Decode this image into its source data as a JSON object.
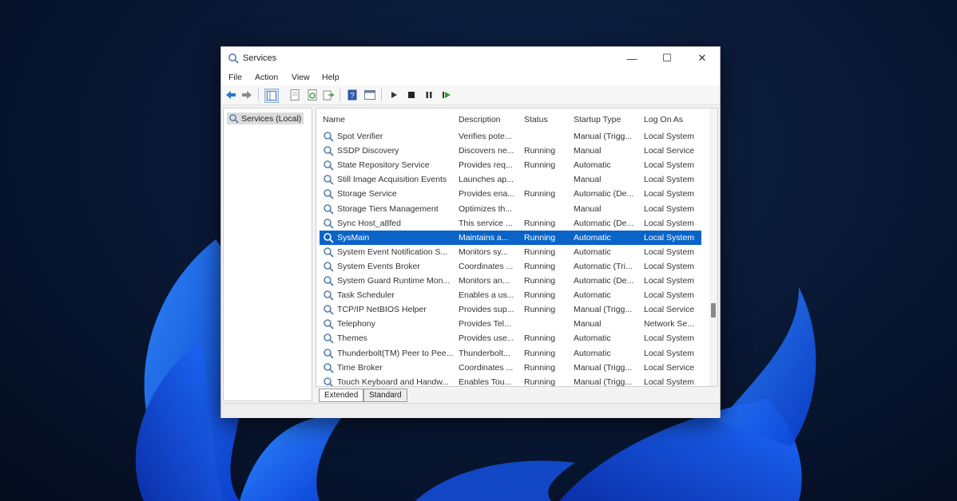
{
  "window": {
    "title": "Services",
    "caption": {
      "minimize": "—",
      "maximize": "☐",
      "close": "✕"
    }
  },
  "menu": [
    "File",
    "Action",
    "View",
    "Help"
  ],
  "toolbar": [
    "back-icon",
    "forward-icon",
    "console-tree-icon",
    "properties-icon",
    "refresh-icon",
    "export-icon",
    "help-icon",
    "view-icon",
    "play-icon",
    "stop-icon",
    "pause-icon",
    "restart-icon"
  ],
  "tree": {
    "label": "Services (Local)"
  },
  "table": {
    "columns": [
      "Name",
      "Description",
      "Status",
      "Startup Type",
      "Log On As"
    ],
    "selected_index": 7,
    "rows": [
      [
        "Spot Verifier",
        "Verifies pote...",
        "",
        "Manual (Trigg...",
        "Local System"
      ],
      [
        "SSDP Discovery",
        "Discovers ne...",
        "Running",
        "Manual",
        "Local Service"
      ],
      [
        "State Repository Service",
        "Provides req...",
        "Running",
        "Automatic",
        "Local System"
      ],
      [
        "Still Image Acquisition Events",
        "Launches ap...",
        "",
        "Manual",
        "Local System"
      ],
      [
        "Storage Service",
        "Provides ena...",
        "Running",
        "Automatic (De...",
        "Local System"
      ],
      [
        "Storage Tiers Management",
        "Optimizes th...",
        "",
        "Manual",
        "Local System"
      ],
      [
        "Sync Host_a8fed",
        "This service ...",
        "Running",
        "Automatic (De...",
        "Local System"
      ],
      [
        "SysMain",
        "Maintains a...",
        "Running",
        "Automatic",
        "Local System"
      ],
      [
        "System Event Notification S...",
        "Monitors sy...",
        "Running",
        "Automatic",
        "Local System"
      ],
      [
        "System Events Broker",
        "Coordinates ...",
        "Running",
        "Automatic (Tri...",
        "Local System"
      ],
      [
        "System Guard Runtime Mon...",
        "Monitors an...",
        "Running",
        "Automatic (De...",
        "Local System"
      ],
      [
        "Task Scheduler",
        "Enables a us...",
        "Running",
        "Automatic",
        "Local System"
      ],
      [
        "TCP/IP NetBIOS Helper",
        "Provides sup...",
        "Running",
        "Manual (Trigg...",
        "Local Service"
      ],
      [
        "Telephony",
        "Provides Tel...",
        "",
        "Manual",
        "Network Se..."
      ],
      [
        "Themes",
        "Provides use...",
        "Running",
        "Automatic",
        "Local System"
      ],
      [
        "Thunderbolt(TM) Peer to Pee...",
        "Thunderbolt...",
        "Running",
        "Automatic",
        "Local System"
      ],
      [
        "Time Broker",
        "Coordinates ...",
        "Running",
        "Manual (Trigg...",
        "Local Service"
      ],
      [
        "Touch Keyboard and Handw...",
        "Enables Tou...",
        "Running",
        "Manual (Trigg...",
        "Local System"
      ]
    ]
  },
  "tabs": [
    "Extended",
    "Standard"
  ]
}
